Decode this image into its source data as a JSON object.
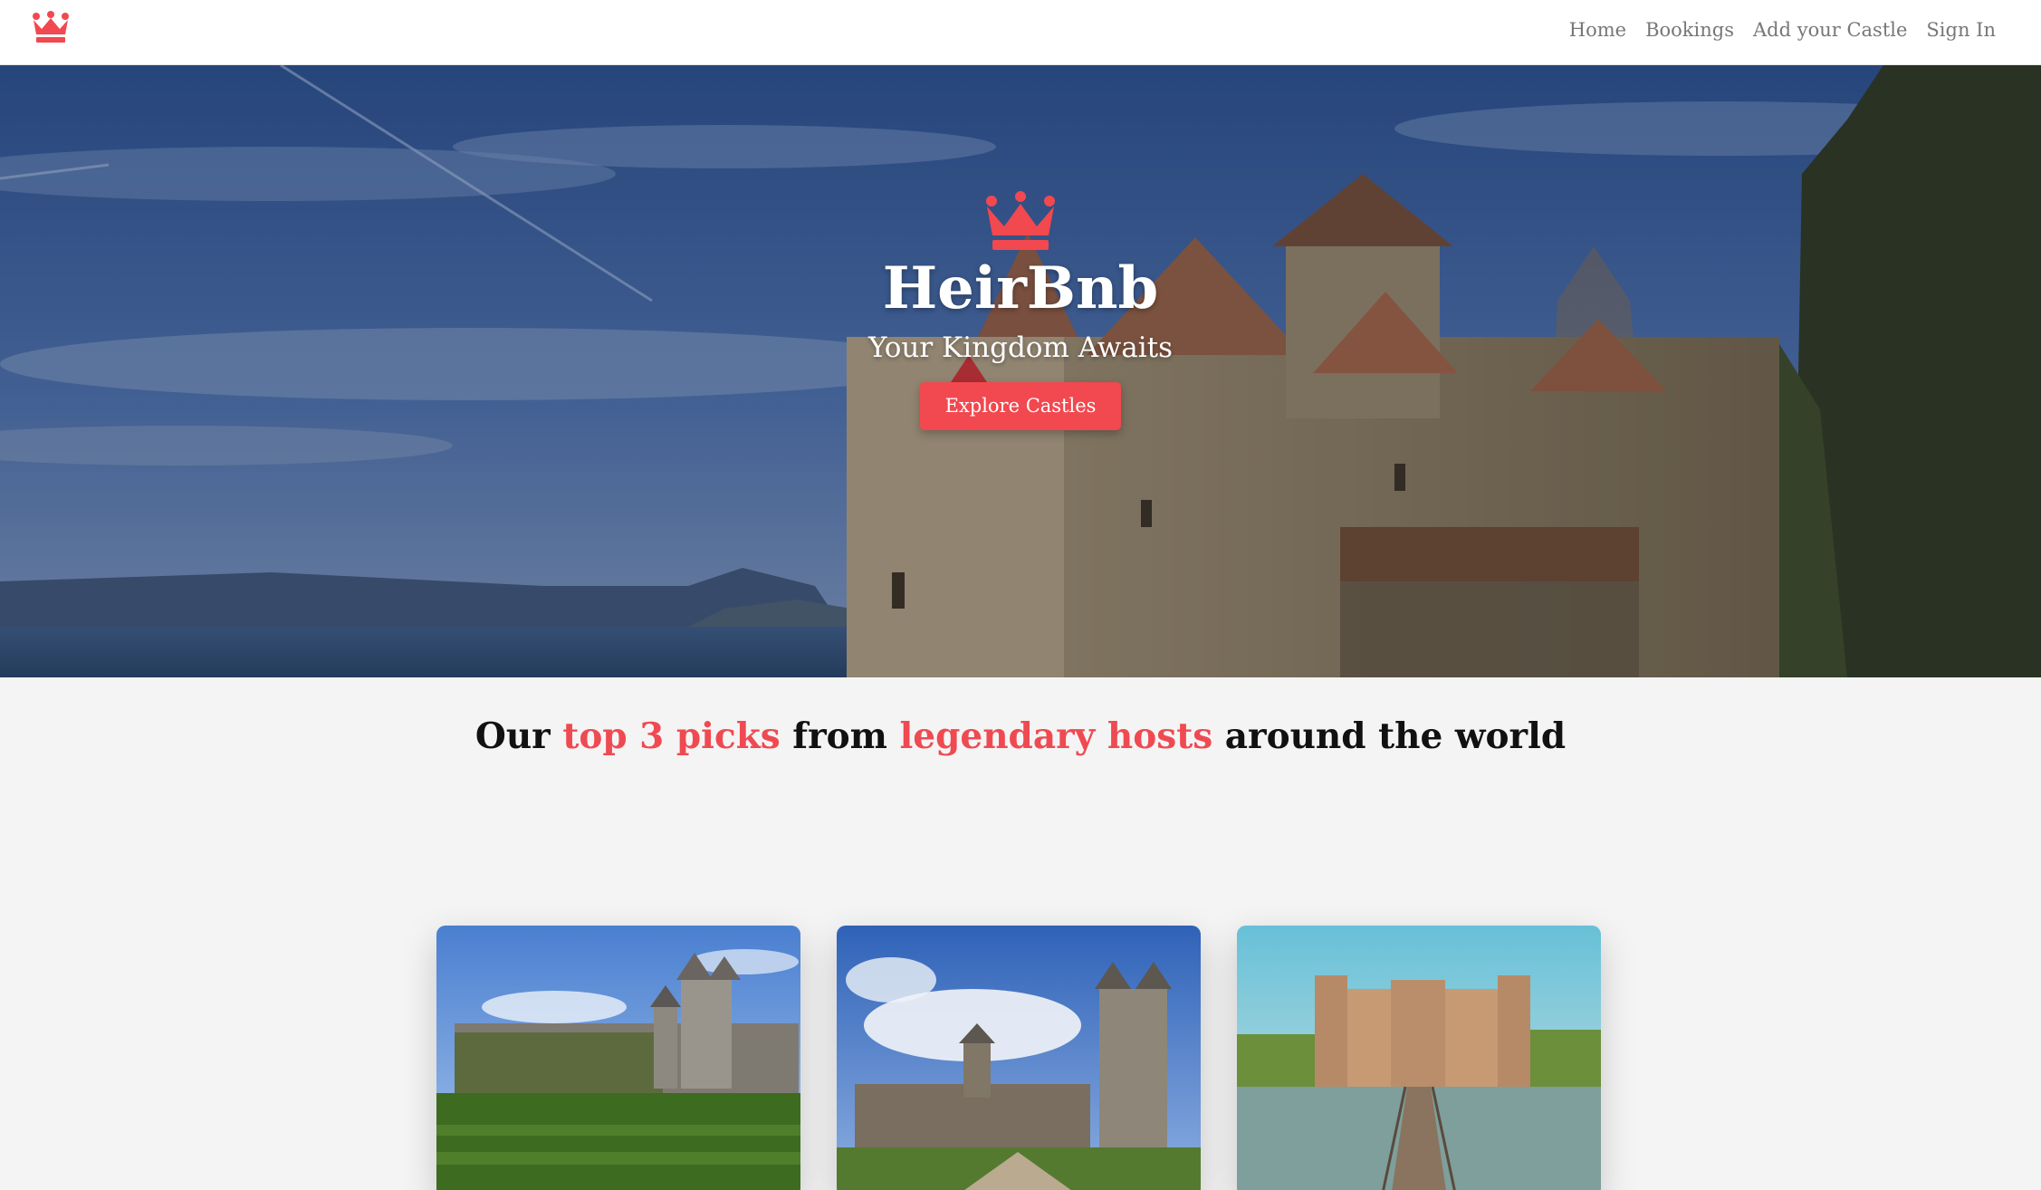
{
  "brand": {
    "logo_icon": "crown-icon",
    "accent_color": "#f2484f",
    "title": "HeirBnb",
    "tagline": "Your Kingdom Awaits"
  },
  "nav": {
    "items": [
      {
        "label": "Home"
      },
      {
        "label": "Bookings"
      },
      {
        "label": "Add your Castle"
      },
      {
        "label": "Sign In"
      }
    ]
  },
  "hero": {
    "cta_label": "Explore Castles"
  },
  "picks": {
    "heading_parts": {
      "p1": "Our ",
      "h1": "top 3 picks",
      "p2": " from ",
      "h2": "legendary hosts",
      "p3": " around the world"
    },
    "cards": [
      {
        "image": "castle-photo-1"
      },
      {
        "image": "castle-photo-2"
      },
      {
        "image": "castle-photo-3"
      }
    ]
  }
}
